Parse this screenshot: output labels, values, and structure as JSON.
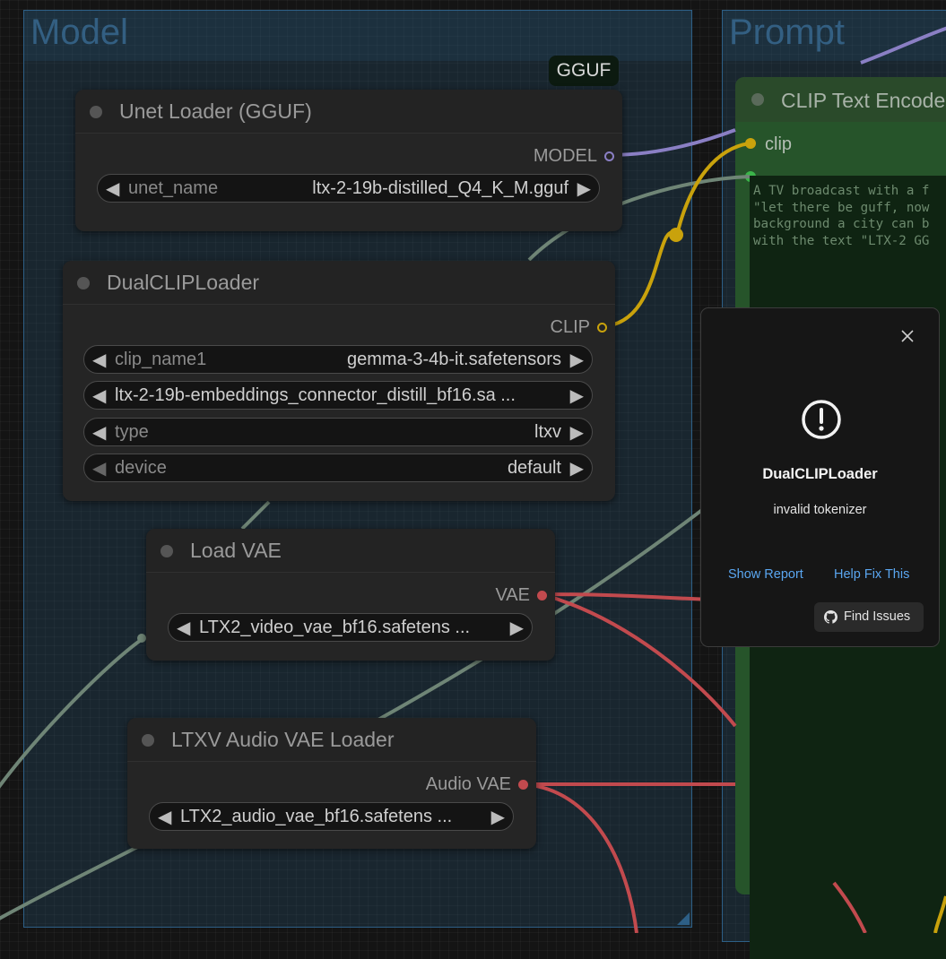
{
  "groups": {
    "model": "Model",
    "prompt": "Prompt"
  },
  "badge": "GGUF",
  "nodes": {
    "unet": {
      "title": "Unet Loader (GGUF)",
      "output": "MODEL",
      "widget": {
        "name": "unet_name",
        "value": "ltx-2-19b-distilled_Q4_K_M.gguf"
      }
    },
    "dualclip": {
      "title": "DualCLIPLoader",
      "output": "CLIP",
      "widgets": [
        {
          "name": "clip_name1",
          "value": "gemma-3-4b-it.safetensors"
        },
        {
          "full": "ltx-2-19b-embeddings_connector_distill_bf16.sa ..."
        },
        {
          "name": "type",
          "value": "ltxv"
        },
        {
          "name": "device",
          "value": "default"
        }
      ]
    },
    "vae": {
      "title": "Load VAE",
      "output": "VAE",
      "widget": {
        "full": "LTX2_video_vae_bf16.safetens ..."
      }
    },
    "audio_vae": {
      "title": "LTXV Audio VAE Loader",
      "output": "Audio VAE",
      "widget": {
        "full": "LTX2_audio_vae_bf16.safetens ..."
      }
    },
    "clip_text": {
      "title": "CLIP Text Encode",
      "input": "clip",
      "text_lines": [
        "A TV broadcast with a f",
        "\"let there be guff, now",
        "background a city can b",
        "with the text \"LTX-2 GG"
      ]
    }
  },
  "popup": {
    "title": "DualCLIPLoader",
    "message": "invalid tokenizer",
    "show_report": "Show Report",
    "help_fix": "Help Fix This",
    "find_issues": "Find Issues"
  },
  "colors": {
    "model_wire": "#8a7fc4",
    "clip_wire": "#c9a20c",
    "vae_wire": "#c24a4e",
    "gray_wire": "#6f8576",
    "link_blue": "#5aa6f0"
  },
  "icons": {
    "close": "close-icon",
    "warning": "exclamation-circle-icon",
    "github": "github-icon"
  }
}
